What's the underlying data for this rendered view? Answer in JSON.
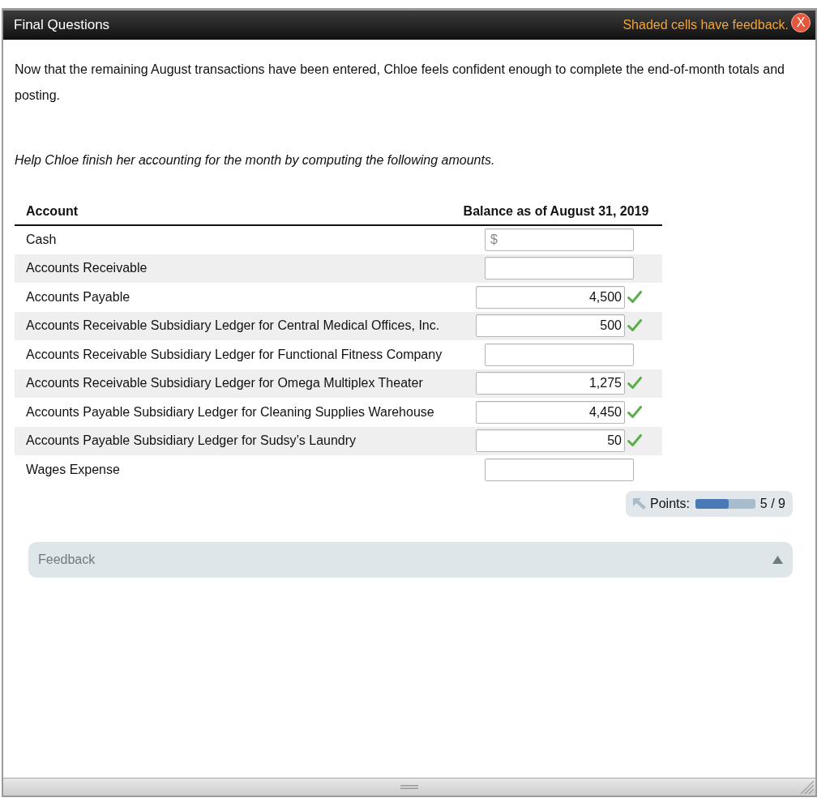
{
  "window": {
    "title": "Final Questions",
    "feedback_note": "Shaded cells have feedback.",
    "close_label": "X"
  },
  "intro": "Now that the remaining August transactions have been entered, Chloe feels confident enough to complete the end-of-month totals and posting.",
  "instruction": "Help Chloe finish her accounting for the month by computing the following amounts.",
  "table": {
    "columns": [
      "Account",
      "Balance as of August 31, 2019"
    ],
    "rows": [
      {
        "account": "Cash",
        "prefix": "$",
        "correct": false
      },
      {
        "account": "Accounts Receivable",
        "correct": false
      },
      {
        "account": "Accounts Payable",
        "answer": "4,500",
        "correct": true
      },
      {
        "account": "Accounts Receivable Subsidiary Ledger for Central Medical Offices, Inc.",
        "answer": "500",
        "correct": true
      },
      {
        "account": "Accounts Receivable Subsidiary Ledger for Functional Fitness Company",
        "correct": false
      },
      {
        "account": "Accounts Receivable Subsidiary Ledger for Omega Multiplex Theater",
        "answer": "1,275",
        "correct": true
      },
      {
        "account": "Accounts Payable Subsidiary Ledger for Cleaning Supplies Warehouse",
        "answer": "4,450",
        "correct": true
      },
      {
        "account": "Accounts Payable Subsidiary Ledger for Sudsy’s Laundry",
        "answer": "50",
        "correct": true
      },
      {
        "account": "Wages Expense",
        "correct": false
      }
    ]
  },
  "points": {
    "label": "Points:",
    "level": 0.56,
    "score": "5 / 9"
  },
  "feedback": {
    "label": "Feedback"
  }
}
